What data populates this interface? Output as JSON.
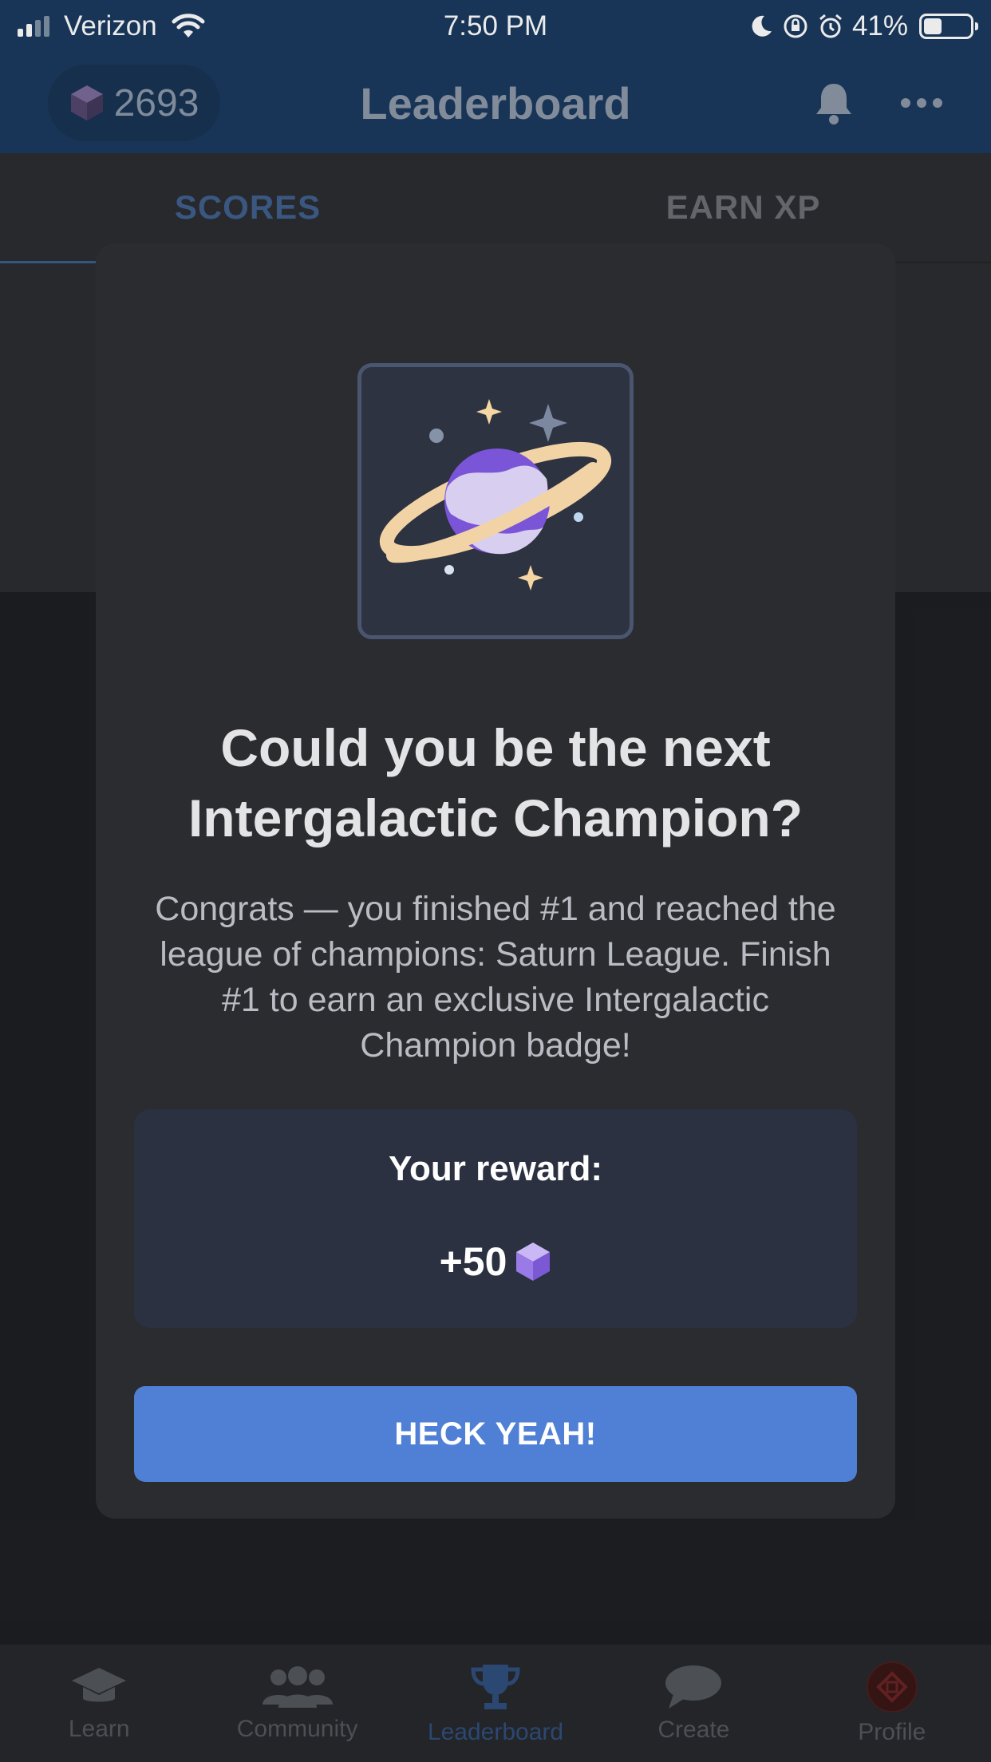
{
  "status_bar": {
    "carrier": "Verizon",
    "time": "7:50 PM",
    "battery": "41%",
    "battery_level": 0.41,
    "icons": [
      "signal-icon",
      "wifi-icon",
      "moon-icon",
      "orientation-lock-icon",
      "alarm-icon",
      "battery-icon"
    ]
  },
  "header": {
    "gem_count": "2693",
    "title": "Leaderboard",
    "icons": [
      "bell-icon",
      "more-icon"
    ]
  },
  "tabs": [
    {
      "label": "SCORES",
      "active": true
    },
    {
      "label": "EARN XP",
      "active": false
    }
  ],
  "modal": {
    "title_line1": "Could you be the next",
    "title_line2": "Intergalactic Champion?",
    "desc_line1": "Congrats — you finished #1 and reached the",
    "desc_line2": "league of champions: Saturn League. Finish",
    "desc_line3": "#1 to earn an exclusive Intergalactic",
    "desc_line4": "Champion badge!",
    "reward_label": "Your reward:",
    "reward_amount": "+50",
    "cta_label": "HECK YEAH!"
  },
  "nav": [
    {
      "label": "Learn",
      "icon": "graduation-cap-icon"
    },
    {
      "label": "Community",
      "icon": "people-icon"
    },
    {
      "label": "Leaderboard",
      "icon": "trophy-icon",
      "active": true
    },
    {
      "label": "Create",
      "icon": "chat-bubble-icon"
    },
    {
      "label": "Profile",
      "icon": "avatar"
    }
  ],
  "colors": {
    "header_bg": "#1b3a5f",
    "modal_bg": "#2b2c30",
    "cta": "#5080d5",
    "gem": "#8b6be0"
  }
}
